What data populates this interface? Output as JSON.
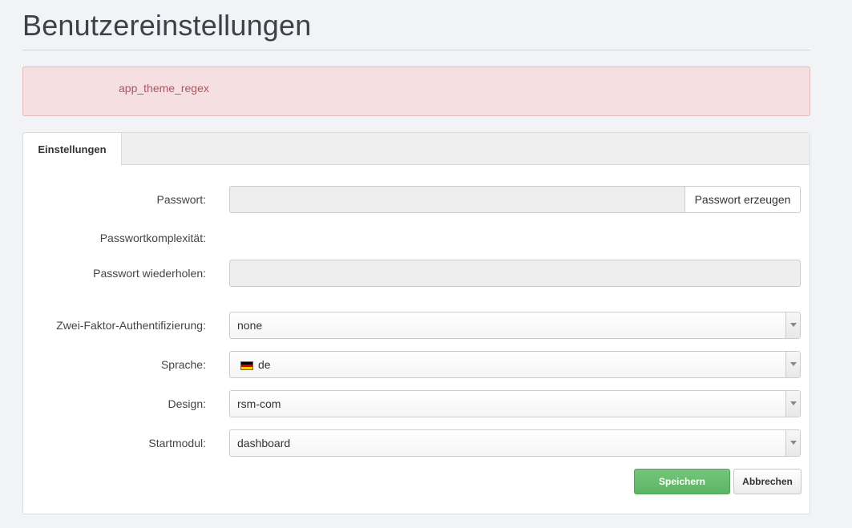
{
  "page": {
    "title": "Benutzereinstellungen"
  },
  "alert": {
    "message": "app_theme_regex"
  },
  "tabs": [
    {
      "label": "Einstellungen",
      "active": true
    }
  ],
  "form": {
    "password": {
      "label": "Passwort:",
      "value": "",
      "generate_label": "Passwort erzeugen"
    },
    "complexity": {
      "label": "Passwortkomplexität:"
    },
    "password_repeat": {
      "label": "Passwort wiederholen:",
      "value": ""
    },
    "two_factor": {
      "label": "Zwei-Faktor-Authentifizierung:",
      "value": "none"
    },
    "language": {
      "label": "Sprache:",
      "value": "de",
      "flag_icon": "germany-flag-icon"
    },
    "design": {
      "label": "Design:",
      "value": "rsm-com"
    },
    "start_module": {
      "label": "Startmodul:",
      "value": "dashboard"
    }
  },
  "actions": {
    "save_label": "Speichern",
    "cancel_label": "Abbrechen"
  },
  "colors": {
    "alert_bg": "#f6dfe0",
    "alert_text": "#a25a60",
    "save_button": "#5cb563"
  }
}
